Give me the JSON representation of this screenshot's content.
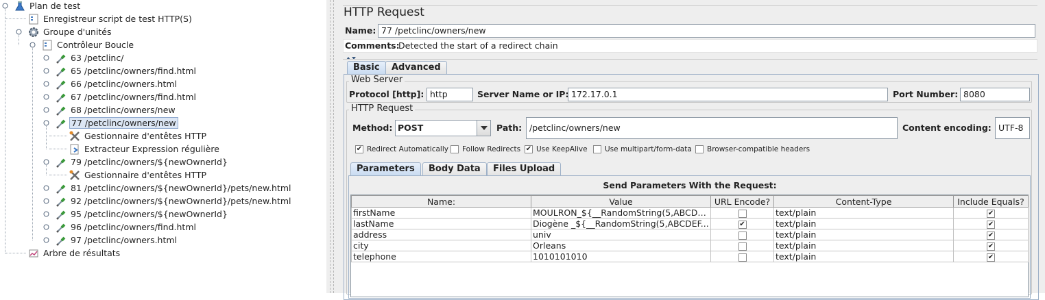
{
  "tree": {
    "items": [
      {
        "label": "Plan de test",
        "icon": "test-plan-flask-icon"
      },
      {
        "label": "Enregistreur script de test HTTP(S)",
        "icon": "recorder-icon"
      },
      {
        "label": "Groupe d'unités",
        "icon": "thread-group-gear-icon"
      },
      {
        "label": "Contrôleur Boucle",
        "icon": "loop-controller-icon"
      },
      {
        "label": "63 /petclinc/",
        "icon": "sampler-pipette-icon"
      },
      {
        "label": "65 /petclinc/owners/find.html",
        "icon": "sampler-pipette-icon"
      },
      {
        "label": "66 /petclinc/owners.html",
        "icon": "sampler-pipette-icon"
      },
      {
        "label": "67 /petclinc/owners/find.html",
        "icon": "sampler-pipette-icon"
      },
      {
        "label": "68 /petclinc/owners/new",
        "icon": "sampler-pipette-icon"
      },
      {
        "label": "77 /petclinc/owners/new",
        "icon": "sampler-pipette-icon"
      },
      {
        "label": "Gestionnaire d'entêtes HTTP",
        "icon": "header-manager-tools-icon"
      },
      {
        "label": "Extracteur Expression régulière",
        "icon": "regex-extractor-icon"
      },
      {
        "label": "79 /petclinc/owners/${newOwnerId}",
        "icon": "sampler-pipette-icon"
      },
      {
        "label": "Gestionnaire d'entêtes HTTP",
        "icon": "header-manager-tools-icon"
      },
      {
        "label": "81 /petclinc/owners/${newOwnerId}/pets/new.html",
        "icon": "sampler-pipette-icon"
      },
      {
        "label": "92 /petclinc/owners/${newOwnerId}/pets/new.html",
        "icon": "sampler-pipette-icon"
      },
      {
        "label": "95 /petclinc/owners/${newOwnerId}",
        "icon": "sampler-pipette-icon"
      },
      {
        "label": "96 /petclinc/owners/find.html",
        "icon": "sampler-pipette-icon"
      },
      {
        "label": "97 /petclinc/owners.html",
        "icon": "sampler-pipette-icon"
      },
      {
        "label": "Arbre de résultats",
        "icon": "results-tree-icon"
      }
    ],
    "selected_label": "77 /petclinc/owners/new"
  },
  "panel": {
    "title": "HTTP Request",
    "name_label": "Name:",
    "name_value": "77 /petclinc/owners/new",
    "comments_label": "Comments:",
    "comments_value": "Detected the start of a redirect chain",
    "tabs": [
      "Basic",
      "Advanced"
    ],
    "active_tab": "Basic"
  },
  "web_server": {
    "title": "Web Server",
    "protocol_label": "Protocol [http]:",
    "protocol_value": "http",
    "server_label": "Server Name or IP:",
    "server_value": "172.17.0.1",
    "port_label": "Port Number:",
    "port_value": "8080"
  },
  "http_request": {
    "title": "HTTP Request",
    "method_label": "Method:",
    "method_value": "POST",
    "path_label": "Path:",
    "path_value": "/petclinc/owners/new",
    "encoding_label": "Content encoding:",
    "encoding_value": "UTF-8",
    "options": [
      {
        "label": "Redirect Automatically",
        "checked": true
      },
      {
        "label": "Follow Redirects",
        "checked": false
      },
      {
        "label": "Use KeepAlive",
        "checked": true
      },
      {
        "label": "Use multipart/form-data",
        "checked": false
      },
      {
        "label": "Browser-compatible headers",
        "checked": false
      }
    ],
    "sub_tabs": [
      "Parameters",
      "Body Data",
      "Files Upload"
    ],
    "active_sub_tab": "Parameters"
  },
  "parameters": {
    "heading": "Send Parameters With the Request:",
    "columns": [
      "Name:",
      "Value",
      "URL Encode?",
      "Content-Type",
      "Include Equals?"
    ],
    "rows": [
      {
        "name": "firstName",
        "value": "MOULRON_${__RandomString(5,ABCDEF...",
        "url_encode": false,
        "content_type": "text/plain",
        "include_equals": true
      },
      {
        "name": "lastName",
        "value": "Diogène _${__RandomString(5,ABCDEF...",
        "url_encode": true,
        "content_type": "text/plain",
        "include_equals": true
      },
      {
        "name": "address",
        "value": "univ",
        "url_encode": false,
        "content_type": "text/plain",
        "include_equals": true
      },
      {
        "name": "city",
        "value": "Orleans",
        "url_encode": false,
        "content_type": "text/plain",
        "include_equals": true
      },
      {
        "name": "telephone",
        "value": "1010101010",
        "url_encode": false,
        "content_type": "text/plain",
        "include_equals": true
      }
    ]
  },
  "colors": {
    "selection_bg": "#dce6f4",
    "selection_border": "#8fa9cf",
    "panel_bg": "#eeeeee",
    "active_tab": "#c8daf0"
  }
}
